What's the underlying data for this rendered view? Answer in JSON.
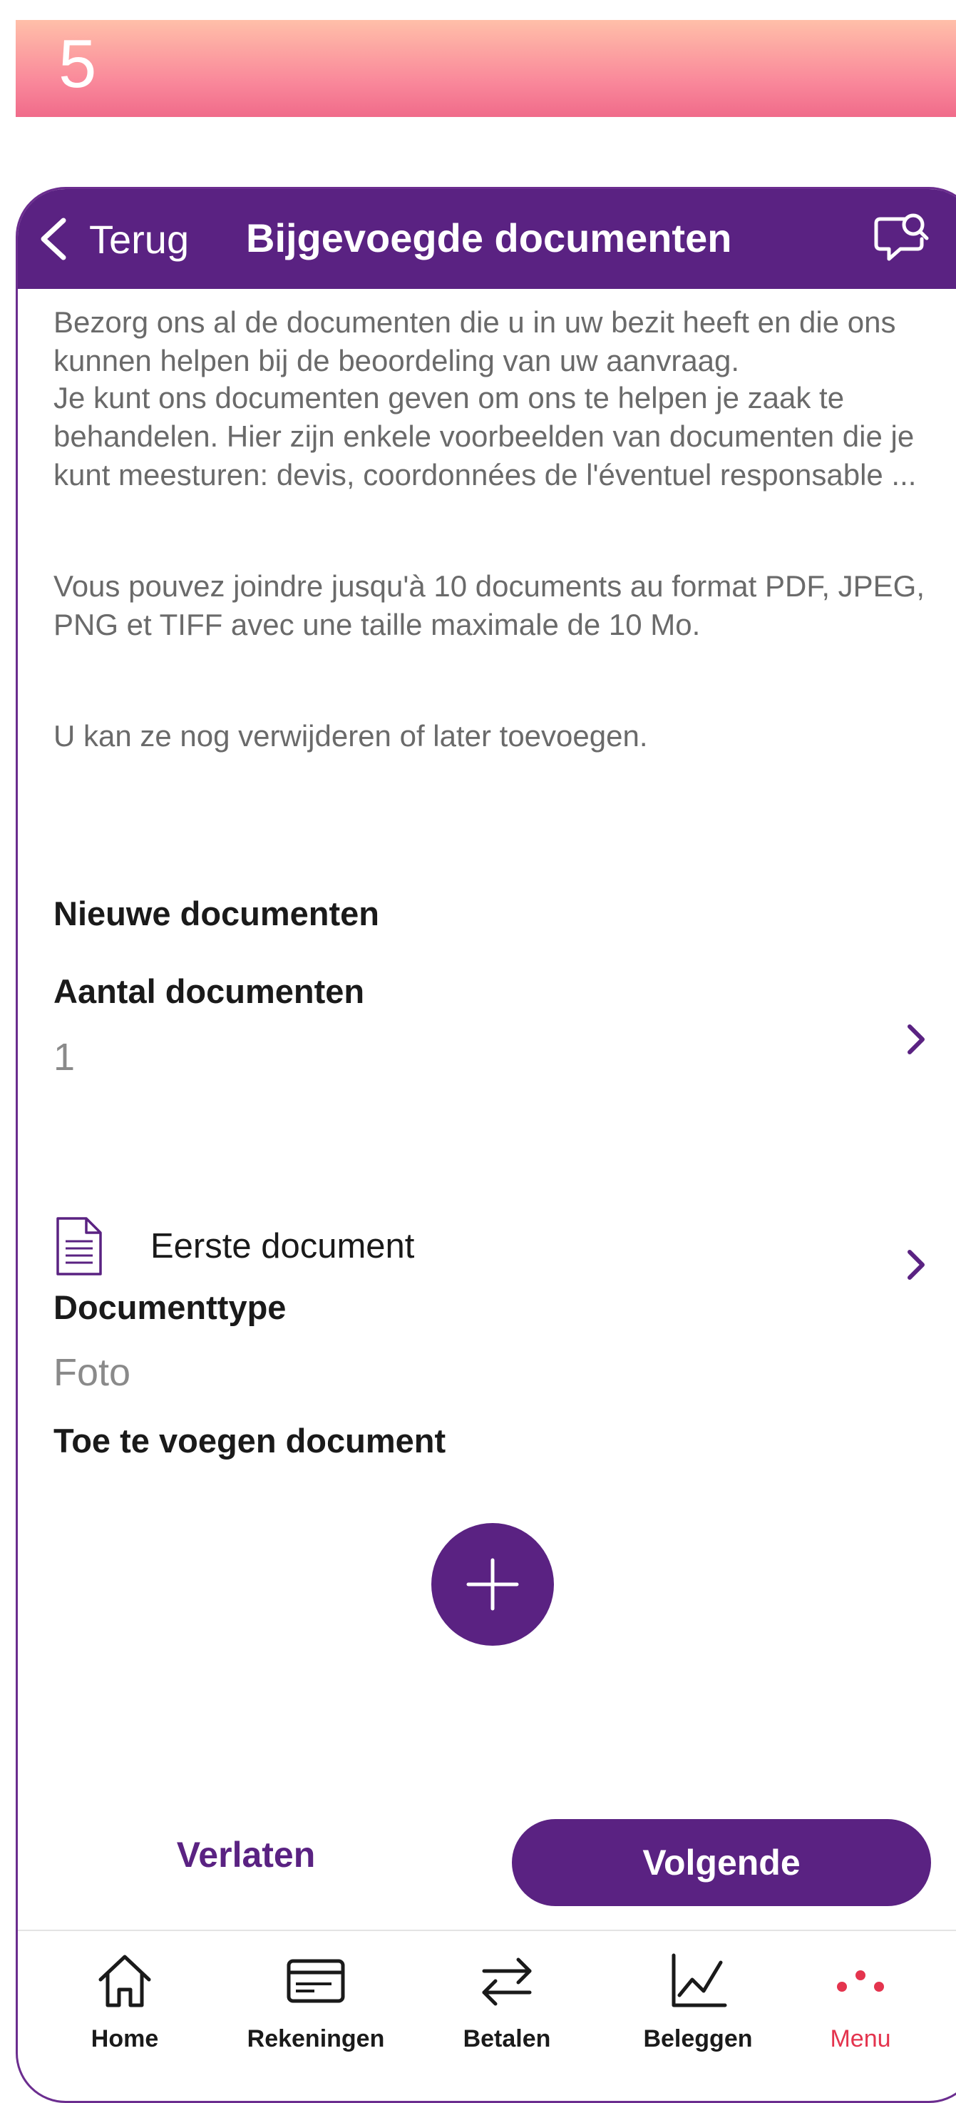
{
  "step_banner": {
    "number": "5"
  },
  "header": {
    "back_label": "Terug",
    "title": "Bijgevoegde documenten",
    "chat_icon": "chat-search-icon"
  },
  "intro": {
    "paragraphs": [
      " Bezorg ons al de documenten die u in uw bezit heeft en die ons kunnen helpen bij de beoordeling van uw aanvraag.",
      "  Je kunt ons documenten geven om ons te helpen je zaak te behandelen. Hier zijn enkele voorbeelden van documenten die je kunt meesturen: devis, coordonnées de l'éventuel responsable ...",
      " Vous pouvez joindre jusqu'à 10 documents au format PDF, JPEG, PNG et TIFF avec une taille maximale de 10 Mo.",
      " U kan ze nog verwijderen of later toevoegen."
    ]
  },
  "new_documents": {
    "section_title": "Nieuwe documenten",
    "count_label": "Aantal documenten",
    "count_value": "1",
    "document": {
      "icon": "document-icon",
      "name": "Eerste document",
      "type_label": "Documenttype",
      "type_value": "Foto",
      "attach_label": "Toe te voegen document"
    }
  },
  "actions": {
    "add_icon": "plus-icon",
    "leave_label": "Verlaten",
    "next_label": "Volgende"
  },
  "tabbar": {
    "items": [
      {
        "label": "Home",
        "icon": "home-icon"
      },
      {
        "label": "Rekeningen",
        "icon": "card-icon"
      },
      {
        "label": "Betalen",
        "icon": "transfer-arrows-icon"
      },
      {
        "label": "Beleggen",
        "icon": "chart-line-icon"
      },
      {
        "label": "Menu",
        "icon": "dots-menu-icon",
        "active": true
      }
    ]
  },
  "colors": {
    "brand_purple": "#5a2282",
    "active_red": "#e4344e",
    "banner_top": "#ffbfa9",
    "banner_bottom": "#f06b8a"
  }
}
